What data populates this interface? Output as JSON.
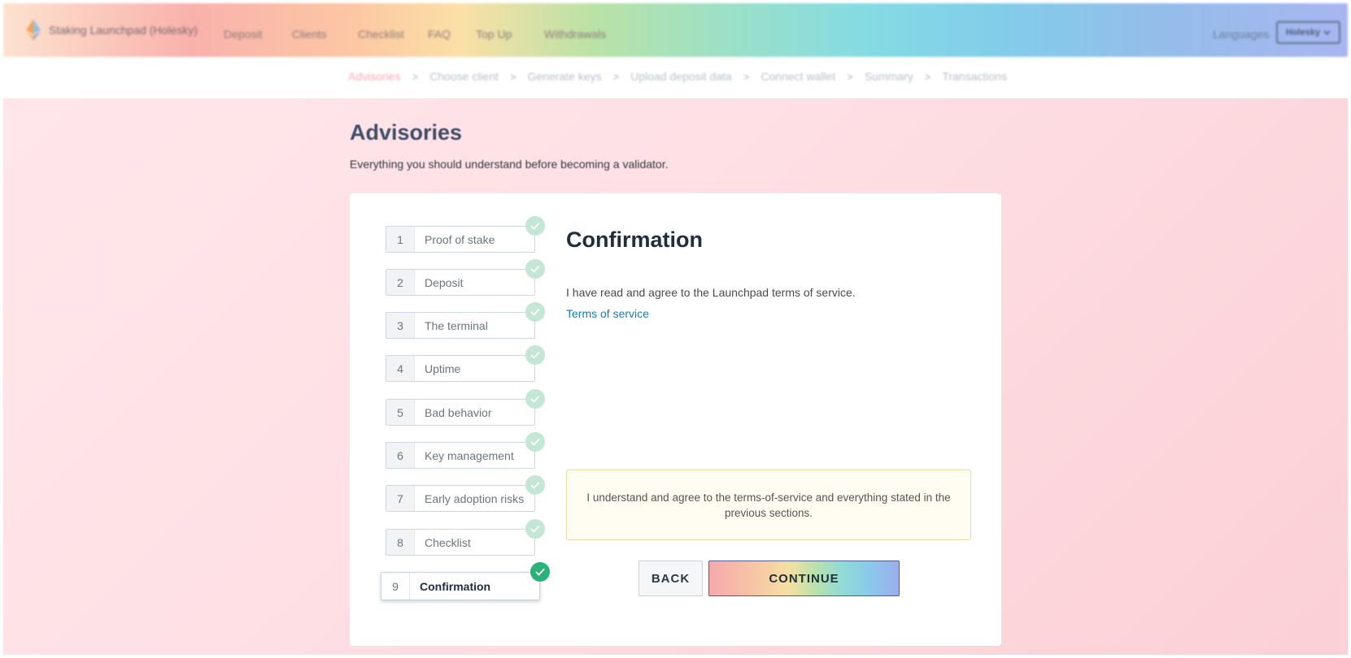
{
  "nav": {
    "brand": "Staking Launchpad (Holesky)",
    "items": [
      "Deposit",
      "Clients",
      "Checklist",
      "FAQ",
      "Top Up",
      "Withdrawals"
    ],
    "languages": "Languages",
    "network": "Holesky"
  },
  "breadcrumb": [
    "Advisories",
    "Choose client",
    "Generate keys",
    "Upload deposit data",
    "Connect wallet",
    "Summary",
    "Transactions"
  ],
  "page": {
    "title": "Advisories",
    "subtitle": "Everything you should understand before becoming a validator."
  },
  "steps": [
    {
      "num": "1",
      "label": "Proof of stake"
    },
    {
      "num": "2",
      "label": "Deposit"
    },
    {
      "num": "3",
      "label": "The terminal"
    },
    {
      "num": "4",
      "label": "Uptime"
    },
    {
      "num": "5",
      "label": "Bad behavior"
    },
    {
      "num": "6",
      "label": "Key management"
    },
    {
      "num": "7",
      "label": "Early adoption risks"
    },
    {
      "num": "8",
      "label": "Checklist"
    },
    {
      "num": "9",
      "label": "Confirmation"
    }
  ],
  "content": {
    "title": "Confirmation",
    "text": "I have read and agree to the Launchpad terms of service.",
    "link": "Terms of service",
    "agree": "I understand and agree to the terms-of-service and everything stated in the previous sections."
  },
  "buttons": {
    "back": "BACK",
    "continue": "CONTINUE"
  }
}
